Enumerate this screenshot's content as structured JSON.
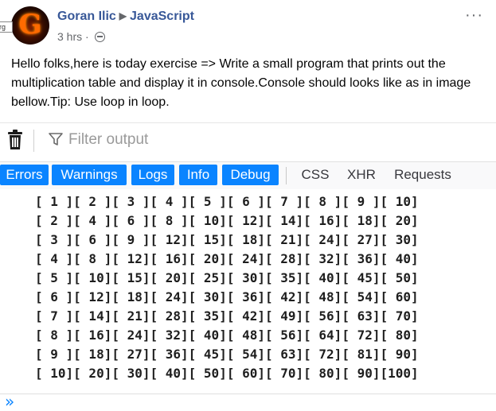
{
  "post": {
    "author": "Goran Ilic",
    "group": "JavaScript",
    "time": "3 hrs",
    "time_sep": "·",
    "avatar_letter": "G",
    "avatar_tag": "rg",
    "more": "···",
    "text": "Hello folks,here is today exercise => Write a small program that prints out the multiplication table and display it in console.Console should looks like as in image bellow.Tip: Use loop in loop."
  },
  "console": {
    "filter_placeholder": "Filter output",
    "tabs": [
      {
        "label": "Errors",
        "active": true
      },
      {
        "label": "Warnings",
        "active": true
      },
      {
        "label": "Logs",
        "active": true
      },
      {
        "label": "Info",
        "active": true
      },
      {
        "label": "Debug",
        "active": true
      },
      {
        "label": "CSS",
        "active": false
      },
      {
        "label": "XHR",
        "active": false
      },
      {
        "label": "Requests",
        "active": false
      }
    ],
    "output_rows": [
      "[ 1 ][ 2 ][ 3 ][ 4 ][ 5 ][ 6 ][ 7 ][ 8 ][ 9 ][ 10]",
      "[ 2 ][ 4 ][ 6 ][ 8 ][ 10][ 12][ 14][ 16][ 18][ 20]",
      "[ 3 ][ 6 ][ 9 ][ 12][ 15][ 18][ 21][ 24][ 27][ 30]",
      "[ 4 ][ 8 ][ 12][ 16][ 20][ 24][ 28][ 32][ 36][ 40]",
      "[ 5 ][ 10][ 15][ 20][ 25][ 30][ 35][ 40][ 45][ 50]",
      "[ 6 ][ 12][ 18][ 24][ 30][ 36][ 42][ 48][ 54][ 60]",
      "[ 7 ][ 14][ 21][ 28][ 35][ 42][ 49][ 56][ 63][ 70]",
      "[ 8 ][ 16][ 24][ 32][ 40][ 48][ 56][ 64][ 72][ 80]",
      "[ 9 ][ 18][ 27][ 36][ 45][ 54][ 63][ 72][ 81][ 90]",
      "[ 10][ 20][ 30][ 40][ 50][ 60][ 70][ 80][ 90][100]"
    ],
    "prompt": "»"
  },
  "colors": {
    "author_link": "#385898",
    "tab_active": "#0a84ff",
    "meta_text": "#65676b"
  }
}
